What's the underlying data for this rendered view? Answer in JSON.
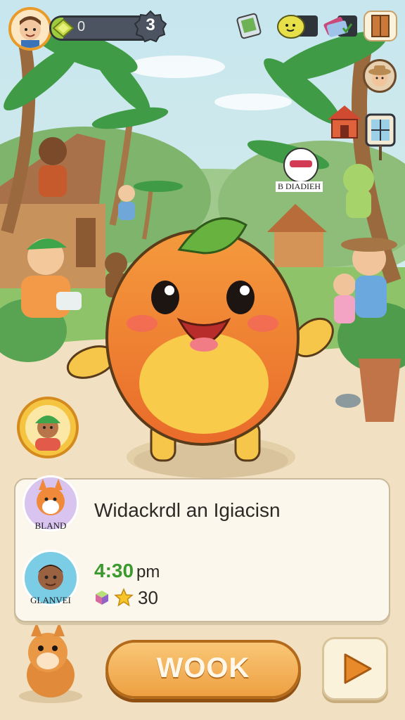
{
  "hud": {
    "xp_value": "0",
    "xp_progress": 0.12,
    "level": "3"
  },
  "icons": {
    "top_right": [
      "map-device-icon",
      "lemon-character-icon",
      "cards-icon",
      "door-icon"
    ],
    "side": [
      "explorer-avatar-icon",
      "red-hut-icon",
      "window-frame-icon"
    ]
  },
  "npc": {
    "label": "B DIADIEH"
  },
  "dialog": {
    "title": "Widackrdl an Igiacisn",
    "speaker_top_label": "BLAND",
    "speaker_bottom_label": "GLANVEI",
    "time_number": "4:30",
    "time_unit": "pm",
    "score": "30"
  },
  "actions": {
    "main_label": "WOOK"
  },
  "colors": {
    "accent_orange": "#eea042",
    "xp_green": "#9ccb3c",
    "time_green": "#3a9a2d",
    "sky": "#cfe9f2"
  }
}
